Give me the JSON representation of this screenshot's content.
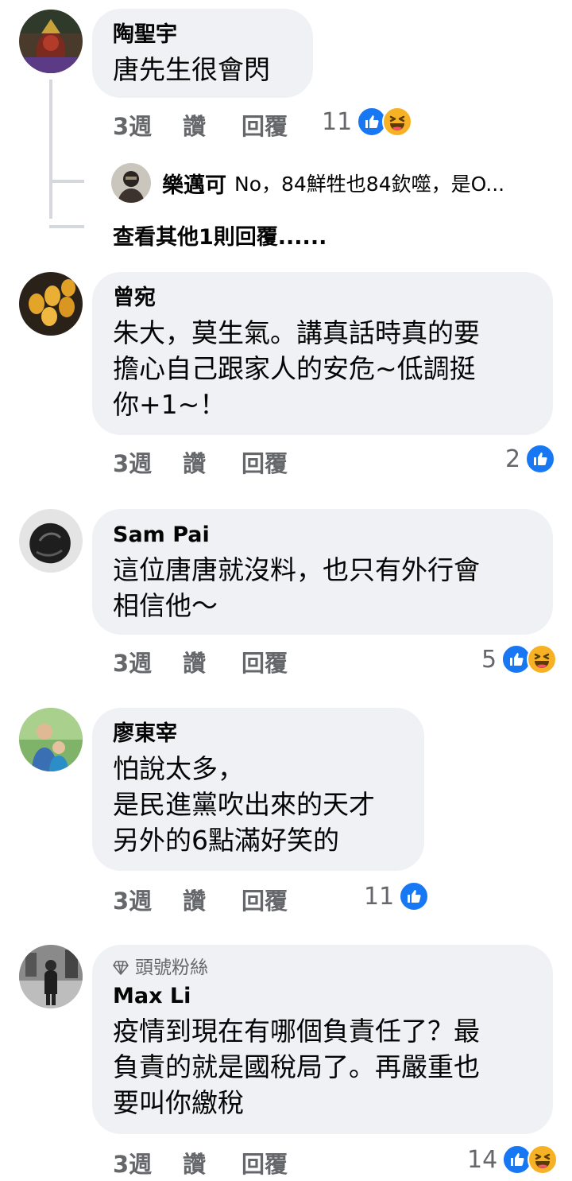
{
  "comments": [
    {
      "name": "陶聖宇",
      "text": "唐先生很會閃",
      "time": "3週",
      "like_label": "讚",
      "reply_label": "回覆",
      "reaction_count": "11",
      "reactions": [
        "like-icon",
        "haha-icon"
      ],
      "replies": {
        "preview_name": "樂邁可",
        "preview_text": "No，84鮮牲也84欽噬，是O...",
        "more_label": "查看其他1則回覆......"
      }
    },
    {
      "name": "曾宛",
      "text": "朱大，莫生氣。講真話時真的要\n擔心自己跟家人的安危~低調挺\n你+1~！",
      "time": "3週",
      "like_label": "讚",
      "reply_label": "回覆",
      "reaction_count": "2",
      "reactions": [
        "like-icon"
      ]
    },
    {
      "name": "Sam Pai",
      "text": "這位唐唐就沒料，也只有外行會\n相信他～",
      "time": "3週",
      "like_label": "讚",
      "reply_label": "回覆",
      "reaction_count": "5",
      "reactions": [
        "like-icon",
        "haha-icon"
      ]
    },
    {
      "name": "廖東宰",
      "text": "怕說太多，\n是民進黨吹出來的天才\n另外的6點滿好笑的",
      "time": "3週",
      "like_label": "讚",
      "reply_label": "回覆",
      "reaction_count": "11",
      "reactions": [
        "like-icon"
      ]
    },
    {
      "badge": "頭號粉絲",
      "name": "Max Li",
      "text": "疫情到現在有哪個負責任了？最\n負責的就是國稅局了。再嚴重也\n要叫你繳稅",
      "time": "3週",
      "like_label": "讚",
      "reply_label": "回覆",
      "reaction_count": "14",
      "reactions": [
        "like-icon",
        "haha-icon"
      ]
    }
  ],
  "colors": {
    "bubble": "#eff1f4",
    "meta_text": "#65676b",
    "like_blue": "#1877f2",
    "haha_yellow": "#f7b125"
  }
}
